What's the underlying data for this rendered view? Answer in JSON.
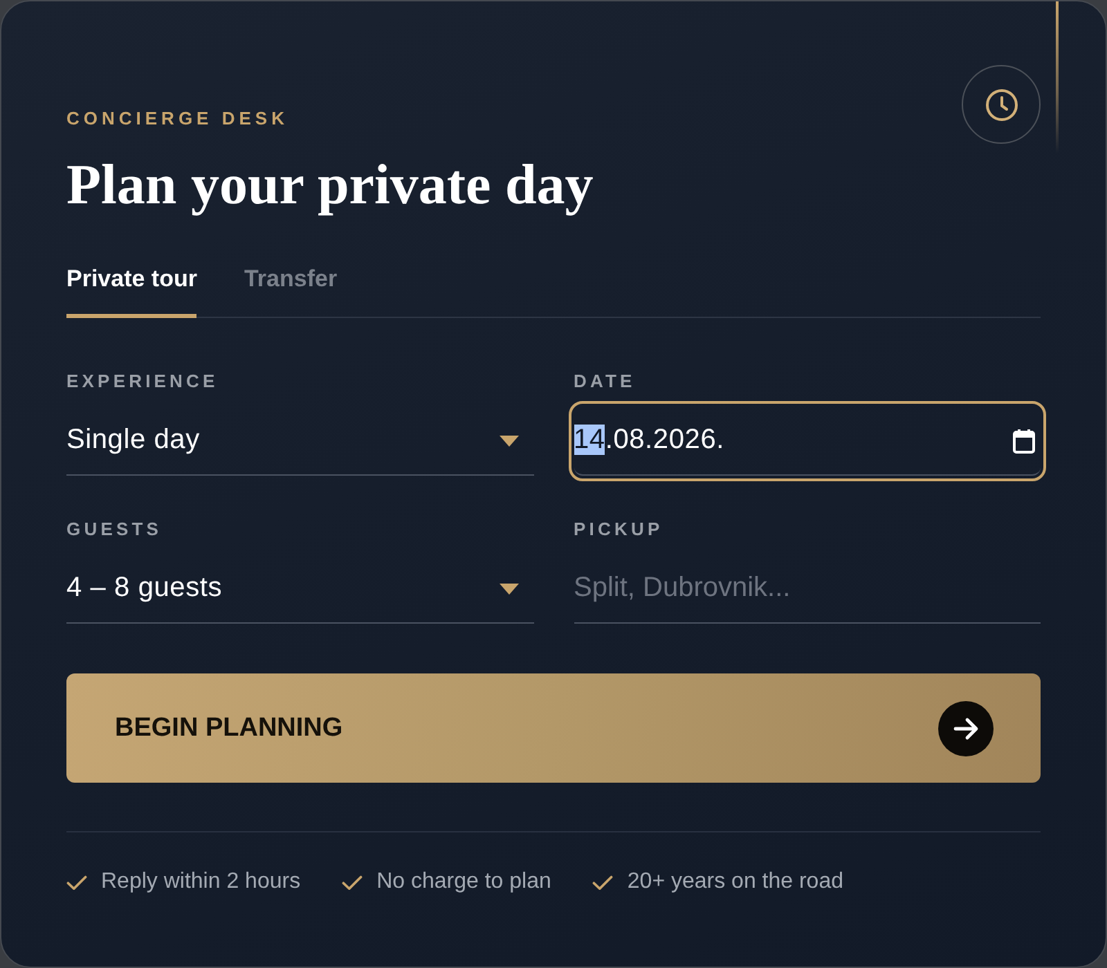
{
  "eyebrow": "CONCIERGE DESK",
  "title": "Plan your private day",
  "tabs": [
    {
      "label": "Private tour",
      "selected": true
    },
    {
      "label": "Transfer",
      "selected": false
    }
  ],
  "fields": [
    {
      "kind": "select",
      "label": "EXPERIENCE",
      "value": "Single day",
      "focused": false
    },
    {
      "kind": "date",
      "label": "DATE",
      "value": "14.08.2026.",
      "focused": true
    },
    {
      "kind": "select",
      "label": "GUESTS",
      "value": "4 – 8 guests",
      "focused": false
    },
    {
      "kind": "text",
      "label": "PICKUP",
      "placeholder": "Split, Dubrovnik...",
      "focused": false
    }
  ],
  "submit_button": {
    "label": "BEGIN PLANNING"
  },
  "features": [
    {
      "label": "Reply within 2 hours"
    },
    {
      "label": "No charge to plan"
    },
    {
      "label": "20+ years on the road"
    }
  ]
}
